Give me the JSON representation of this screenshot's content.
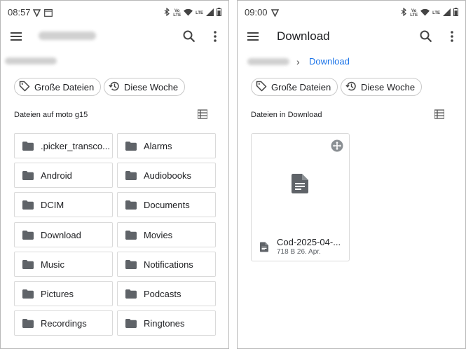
{
  "left_screen": {
    "status": {
      "time": "08:57",
      "volte": [
        "Vo",
        "LTE"
      ],
      "lte": "LTE"
    },
    "chips": [
      "Große Dateien",
      "Diese Woche"
    ],
    "section_label": "Dateien auf moto g15",
    "folders": [
      ".picker_transco...",
      "Alarms",
      "Android",
      "Audiobooks",
      "DCIM",
      "Documents",
      "Download",
      "Movies",
      "Music",
      "Notifications",
      "Pictures",
      "Podcasts",
      "Recordings",
      "Ringtones"
    ]
  },
  "right_screen": {
    "status": {
      "time": "09:00",
      "volte": [
        "Vo",
        "LTE"
      ],
      "lte": "LTE"
    },
    "title": "Download",
    "breadcrumb": {
      "separator": "›",
      "current": "Download"
    },
    "chips": [
      "Große Dateien",
      "Diese Woche"
    ],
    "section_label": "Dateien in Download",
    "file": {
      "name": "Cod-2025-04-...",
      "meta": "718 B 26. Apr."
    }
  },
  "colors": {
    "accent": "#1a73e8",
    "icon": "#5f6368",
    "border": "#dadada"
  }
}
